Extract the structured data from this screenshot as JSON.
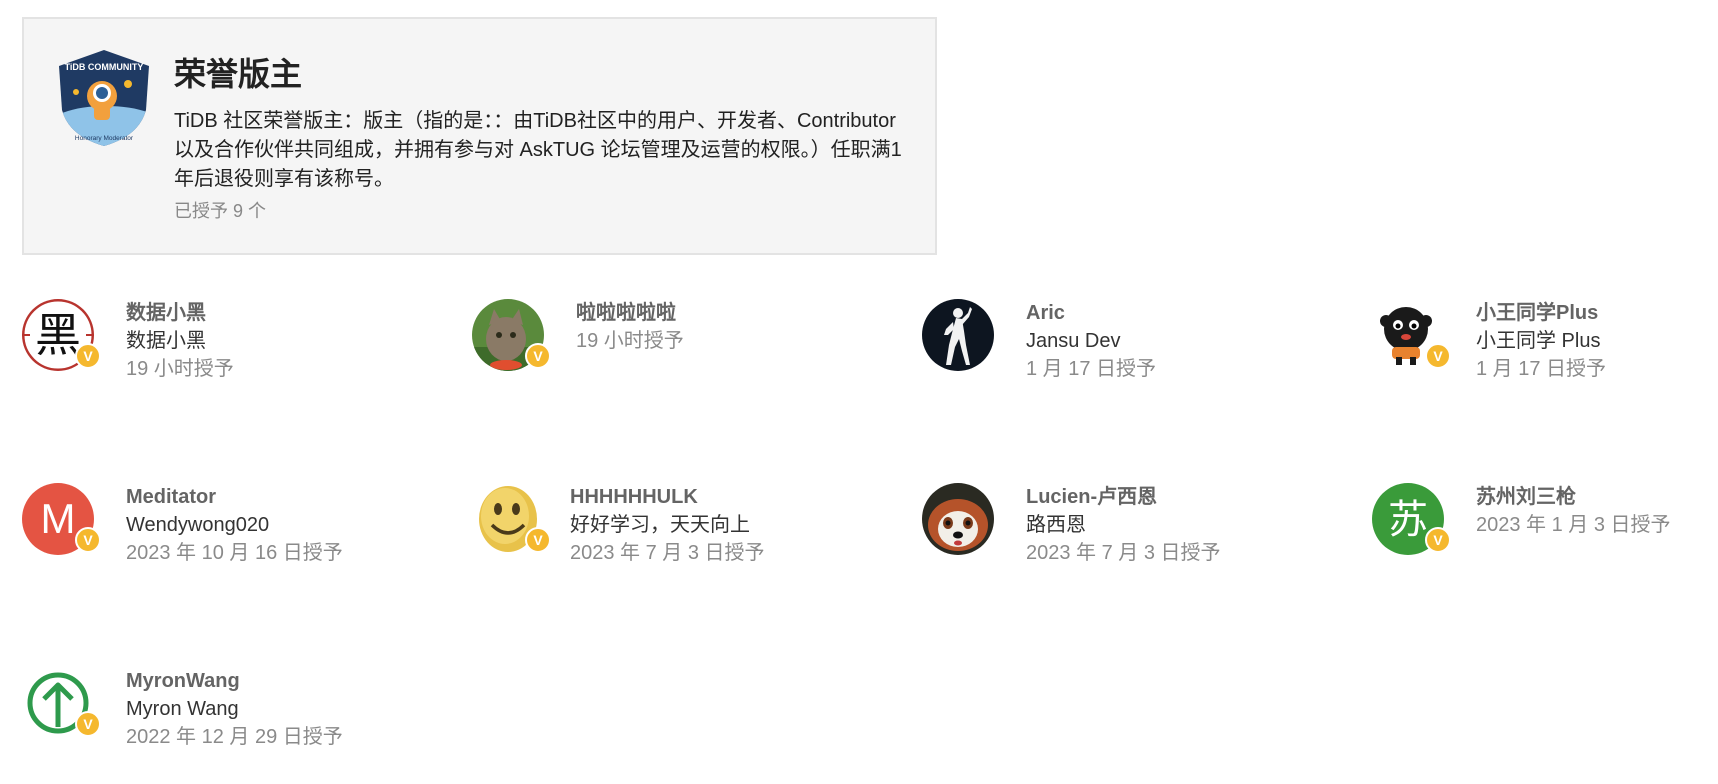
{
  "badge": {
    "icon": "tidb-community-honorary-moderator-badge-icon",
    "icon_text_top": "TiDB COMMUNITY",
    "icon_text_bottom": "Honorary Moderator",
    "title": "荣誉版主",
    "description": "TiDB 社区荣誉版主：版主（指的是：：由TiDB社区中的用户、开发者、Contributor 以及合作伙伴共同组成，并拥有参与对 AskTUG 论坛管理及运营的权限。）任职满1年后退役则享有该称号。",
    "granted_count": "已授予 9 个"
  },
  "flair_letter": "V",
  "colors": {
    "flair": "#f5b82e",
    "card_bg": "#f5f5f5"
  },
  "users": [
    {
      "name": "数据小黑",
      "subtitle": "数据小黑",
      "granted": "19 小时授予",
      "avatar": "hei-calligraphy-avatar",
      "avatar_char": "黑"
    },
    {
      "name": "啦啦啦啦啦",
      "granted": "19 小时授予",
      "avatar": "cat-photo-avatar"
    },
    {
      "name": "Aric",
      "subtitle": "Jansu Dev",
      "granted": "1 月 17 日授予",
      "avatar": "dancer-silhouette-avatar"
    },
    {
      "name": "小王同学Plus",
      "subtitle": "小王同学 Plus",
      "granted": "1 月 17 日授予",
      "avatar": "fluffy-black-creature-avatar"
    },
    {
      "name": "Meditator",
      "subtitle": "Wendywong020",
      "granted": "2023 年 10 月 16 日授予",
      "avatar": "letter-avatar",
      "avatar_char": "M"
    },
    {
      "name": "HHHHHHULK",
      "subtitle": "好好学习，天天向上",
      "granted": "2023 年 7 月 3 日授予",
      "avatar": "smiley-face-avatar"
    },
    {
      "name": "Lucien-卢西恩",
      "subtitle": "路西恩",
      "granted": "2023 年 7 月 3 日授予",
      "avatar": "red-panda-avatar"
    },
    {
      "name": "苏州刘三枪",
      "granted": "2023 年 1 月 3 日授予",
      "avatar": "letter-avatar",
      "avatar_char": "苏"
    },
    {
      "name": "MyronWang",
      "subtitle": "Myron Wang",
      "granted": "2022 年 12 月 29 日授予",
      "avatar": "green-up-arrow-avatar"
    }
  ]
}
